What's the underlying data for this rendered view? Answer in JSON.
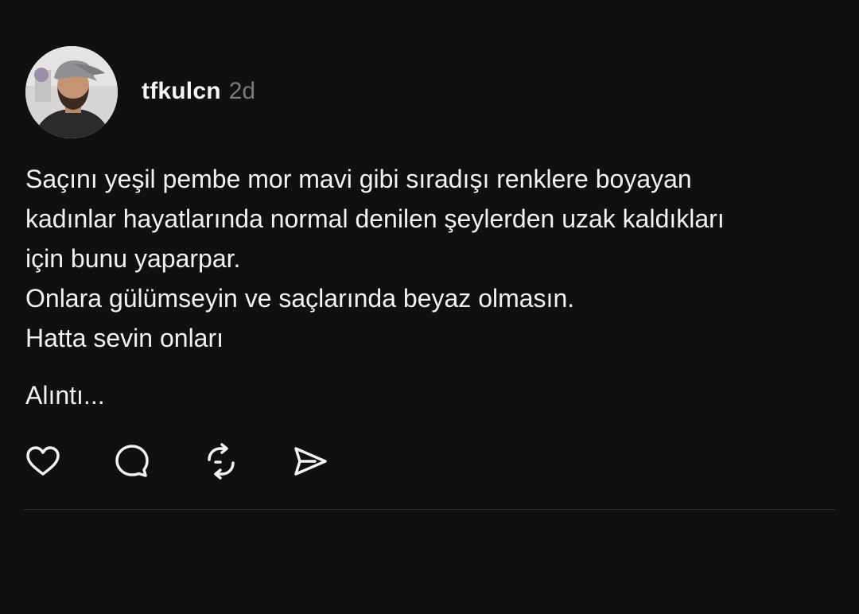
{
  "post": {
    "username": "tfkulcn",
    "timestamp": "2d",
    "body_lines": [
      "Saçını yeşil pembe mor mavi gibi sıradışı renklere boyayan",
      "kadınlar hayatlarında normal denilen şeylerden uzak kaldıkları",
      "için bunu yaparpar.",
      "Onlara gülümseyin ve saçlarında beyaz olmasın.",
      "Hatta sevin onları"
    ],
    "quote_label": "Alıntı..."
  },
  "actions": [
    {
      "icon": "heart-icon",
      "name": "like"
    },
    {
      "icon": "comment-icon",
      "name": "reply"
    },
    {
      "icon": "repost-icon",
      "name": "repost"
    },
    {
      "icon": "send-icon",
      "name": "share"
    }
  ],
  "colors": {
    "background": "#101010",
    "text": "#f2f2f2",
    "muted": "#7a7a7a",
    "divider": "#2c2c2c"
  }
}
